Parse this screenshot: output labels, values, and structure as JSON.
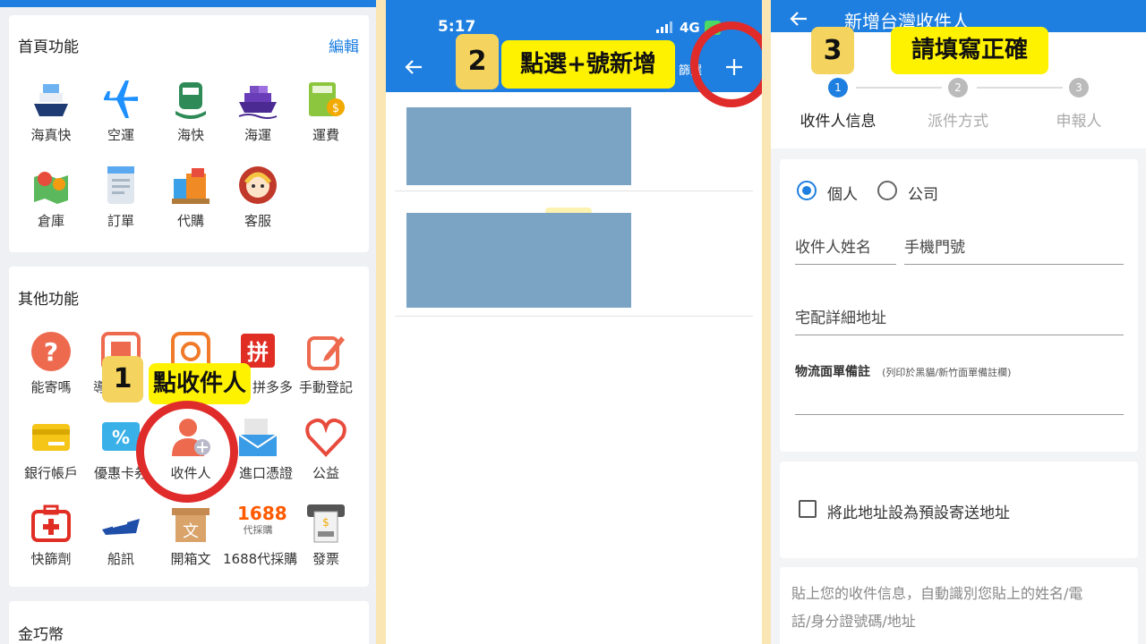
{
  "panel1": {
    "home_section": {
      "title": "首頁功能",
      "edit": "編輯",
      "items": [
        {
          "label": "海真快",
          "icon": "ship-icon"
        },
        {
          "label": "空運",
          "icon": "airplane-icon"
        },
        {
          "label": "海快",
          "icon": "ferry-icon"
        },
        {
          "label": "海運",
          "icon": "cargo-ship-icon"
        },
        {
          "label": "運費",
          "icon": "calculator-icon"
        },
        {
          "label": "倉庫",
          "icon": "map-pin-icon"
        },
        {
          "label": "訂單",
          "icon": "document-icon"
        },
        {
          "label": "代購",
          "icon": "shopping-bags-icon"
        },
        {
          "label": "客服",
          "icon": "customer-service-icon"
        }
      ]
    },
    "other_section": {
      "title": "其他功能",
      "items": [
        {
          "label": "能寄嗎",
          "icon": "question-icon"
        },
        {
          "label": "導",
          "icon": "guide-icon"
        },
        {
          "label": "",
          "icon": "taobao-icon"
        },
        {
          "label": "拼多多",
          "icon": "pinduoduo-icon"
        },
        {
          "label": "手動登記",
          "icon": "edit-icon"
        },
        {
          "label": "銀行帳戶",
          "icon": "bank-card-icon"
        },
        {
          "label": "優惠卡券",
          "icon": "coupon-icon"
        },
        {
          "label": "收件人",
          "icon": "add-user-icon"
        },
        {
          "label": "進口憑證",
          "icon": "receipt-mail-icon"
        },
        {
          "label": "公益",
          "icon": "heart-icon"
        },
        {
          "label": "快篩劑",
          "icon": "first-aid-icon"
        },
        {
          "label": "船訊",
          "icon": "speedboat-icon"
        },
        {
          "label": "開箱文",
          "icon": "unboxing-icon"
        },
        {
          "label": "1688代採購",
          "icon": "1688-icon"
        },
        {
          "label": "發票",
          "icon": "invoice-icon"
        }
      ]
    },
    "coin_section": {
      "title": "金巧幣"
    },
    "step": {
      "num": "1",
      "text": "點收件人"
    },
    "logo_1688": {
      "big": "1688",
      "small": "代採購"
    }
  },
  "panel2": {
    "status_time": "5:17",
    "status_net": "4G",
    "filter_label": "篩選",
    "step": {
      "num": "2",
      "text": "點選+號新增"
    }
  },
  "panel3": {
    "title": "新增台灣收件人",
    "step": {
      "num": "3",
      "text": "請填寫正確"
    },
    "steps": [
      {
        "num": "1",
        "label": "收件人信息"
      },
      {
        "num": "2",
        "label": "派件方式"
      },
      {
        "num": "3",
        "label": "申報人"
      }
    ],
    "radio_personal": "個人",
    "radio_company": "公司",
    "name_label": "收件人姓名",
    "phone_label": "手機門號",
    "address_label": "宅配詳細地址",
    "remark_label": "物流面單備註",
    "remark_hint": "(列印於黑貓/新竹面單備註欄)",
    "default_label": "將此地址設為預設寄送地址",
    "paste_hint": "貼上您的收件信息，自動識別您貼上的姓名/電話/身分證號碼/地址"
  },
  "colors": {
    "primary": "#1e7fe0",
    "highlight": "#fff200",
    "badge": "#f4d35e",
    "ring": "#e02b2b"
  }
}
